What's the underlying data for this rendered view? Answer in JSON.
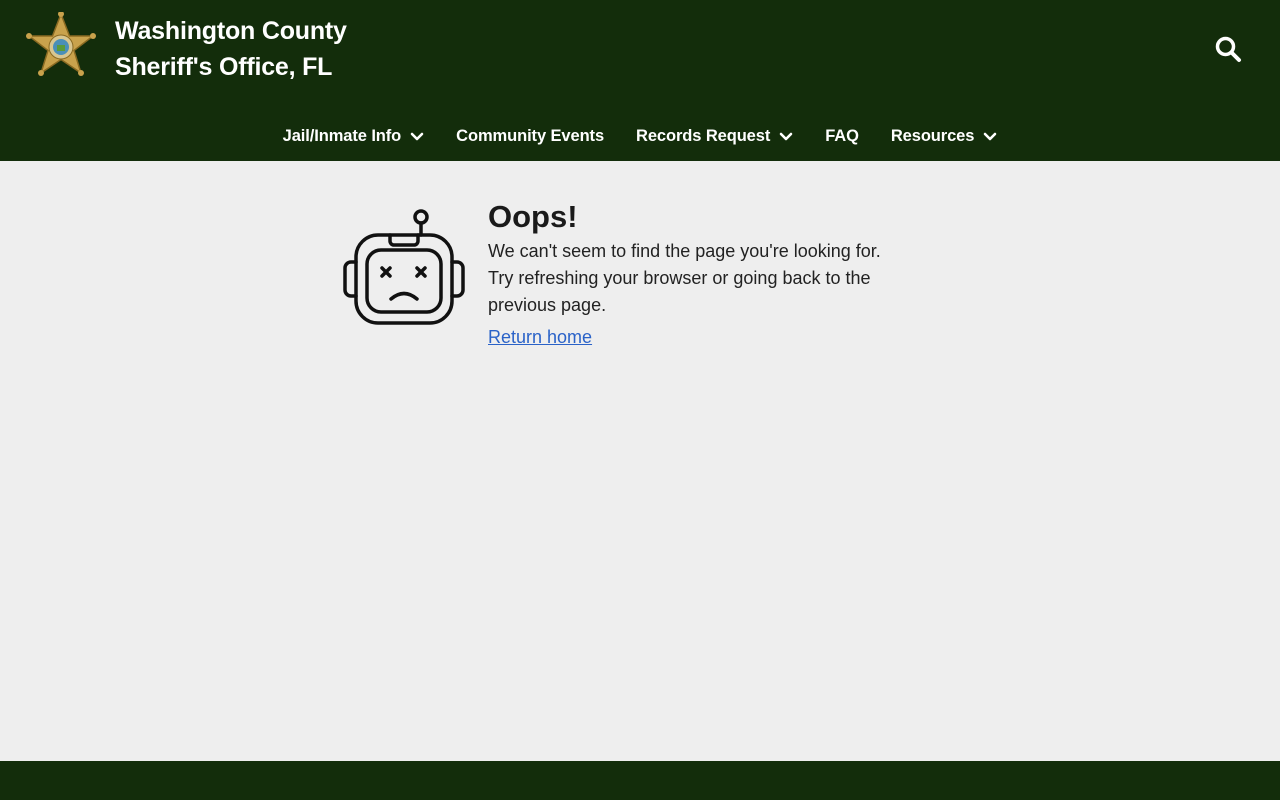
{
  "header": {
    "title_line1": "Washington County",
    "title_line2": "Sheriff's Office, FL",
    "logo_icon": "sheriff-star-badge-icon",
    "search_icon": "search-icon"
  },
  "nav": {
    "items": [
      {
        "label": "Jail/Inmate Info",
        "has_dropdown": true
      },
      {
        "label": "Community Events",
        "has_dropdown": false
      },
      {
        "label": "Records Request",
        "has_dropdown": true
      },
      {
        "label": "FAQ",
        "has_dropdown": false
      },
      {
        "label": "Resources",
        "has_dropdown": true
      }
    ]
  },
  "error": {
    "icon": "sad-robot-icon",
    "heading": "Oops!",
    "line1": "We can't seem to find the page you're looking for.",
    "line2": "Try refreshing your browser or going back to the",
    "line3": "previous page.",
    "link": "Return home"
  },
  "colors": {
    "header_bg": "#132d0b",
    "page_bg": "#eeeeee",
    "link": "#2a62c8"
  }
}
